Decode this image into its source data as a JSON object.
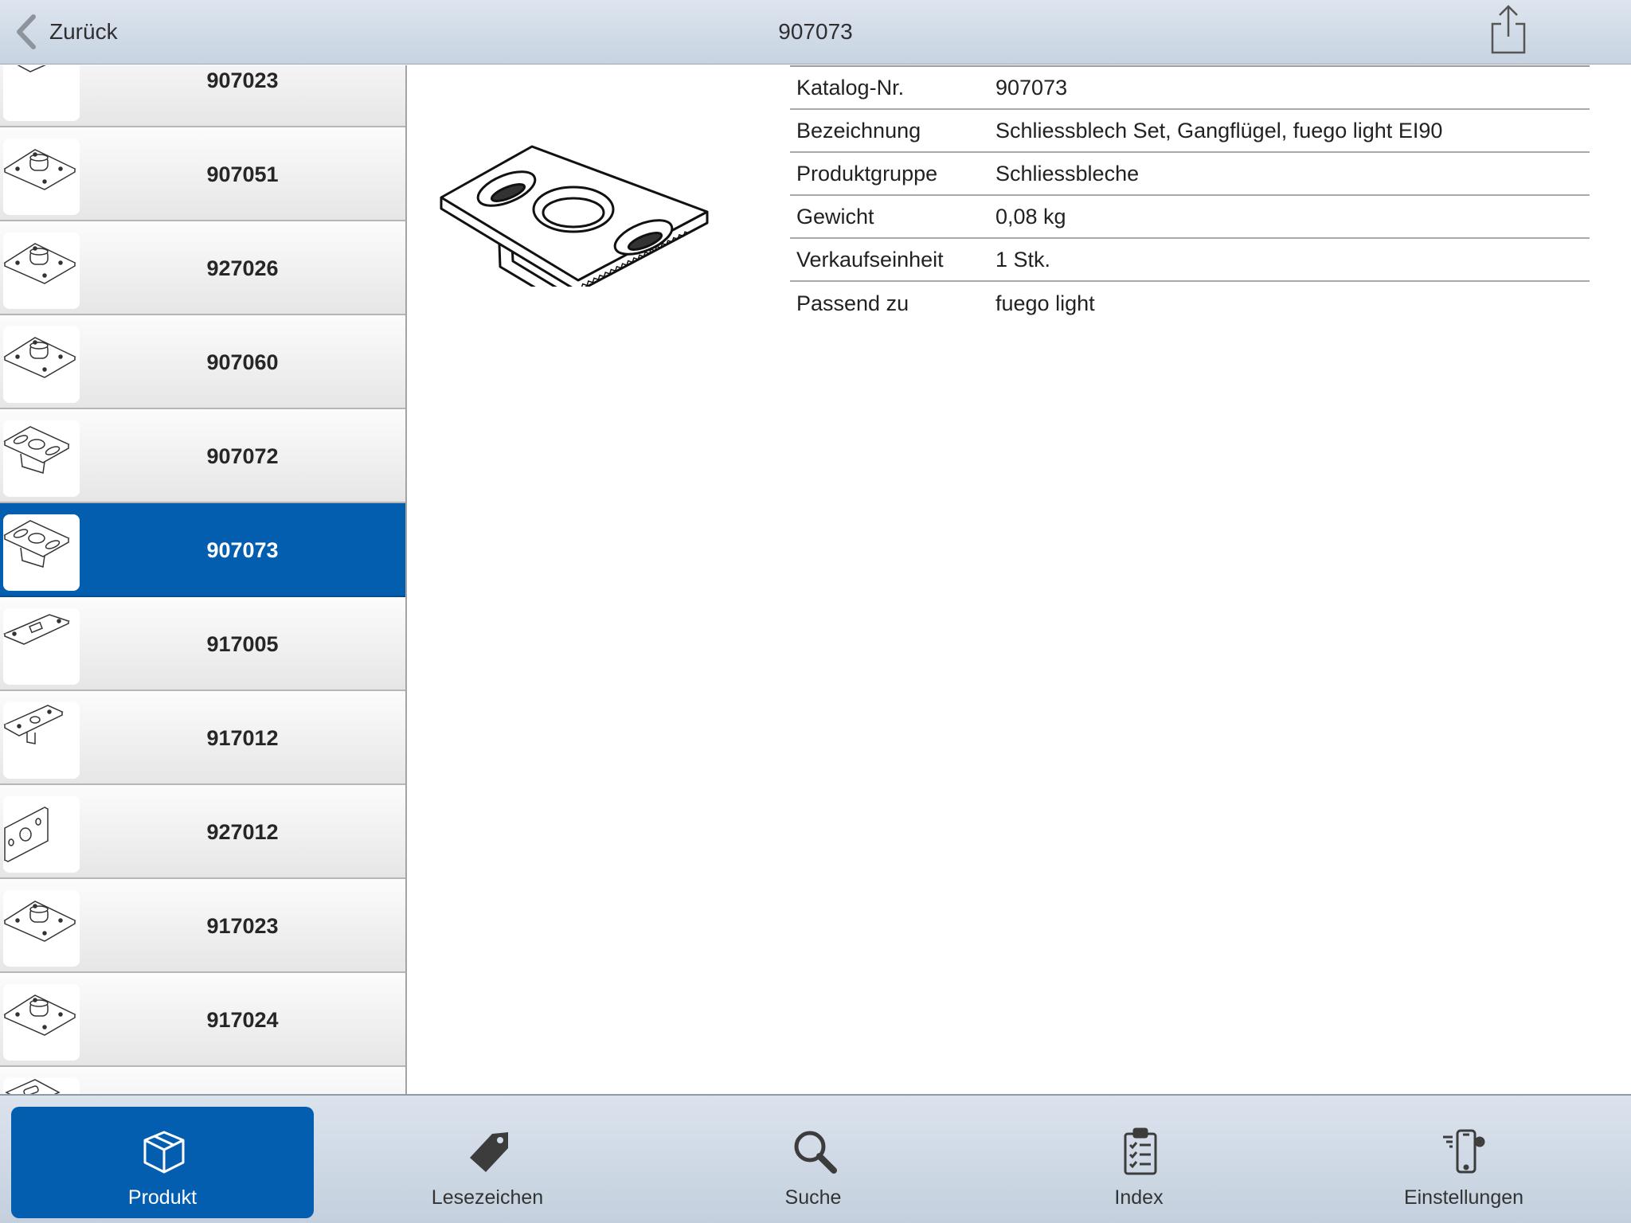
{
  "navbar": {
    "back_label": "Zurück",
    "title": "907073",
    "back_icon": "chevron-left-icon",
    "share_icon": "share-icon"
  },
  "product_list": {
    "items": [
      {
        "label": "907023",
        "thumb": "strike-plate-flat"
      },
      {
        "label": "907051",
        "thumb": "strike-plate-knob"
      },
      {
        "label": "927026",
        "thumb": "strike-plate-knob"
      },
      {
        "label": "907060",
        "thumb": "strike-plate-knob"
      },
      {
        "label": "907072",
        "thumb": "strike-plate-slots"
      },
      {
        "label": "907073",
        "thumb": "strike-plate-slots",
        "selected": true
      },
      {
        "label": "917005",
        "thumb": "strike-plate-rect"
      },
      {
        "label": "917012",
        "thumb": "strike-plate-holes"
      },
      {
        "label": "927012",
        "thumb": "strike-plate-upright"
      },
      {
        "label": "917023",
        "thumb": "strike-plate-knob"
      },
      {
        "label": "917024",
        "thumb": "strike-plate-knob"
      },
      {
        "label": "",
        "thumb": "strike-plate-flat"
      }
    ]
  },
  "detail": {
    "rows": [
      {
        "key": "Katalog-Nr.",
        "value": "907073"
      },
      {
        "key": "Bezeichnung",
        "value": "Schliessblech Set, Gangflügel, fuego light EI90"
      },
      {
        "key": "Produktgruppe",
        "value": "Schliessbleche"
      },
      {
        "key": "Gewicht",
        "value": "0,08 kg"
      },
      {
        "key": "Verkaufseinheit",
        "value": "1 Stk."
      },
      {
        "key": "Passend zu",
        "value": "fuego light"
      }
    ]
  },
  "tabbar": {
    "tabs": [
      {
        "label": "Produkt",
        "icon": "box-icon",
        "active": true
      },
      {
        "label": "Lesezeichen",
        "icon": "tag-icon"
      },
      {
        "label": "Suche",
        "icon": "search-icon"
      },
      {
        "label": "Index",
        "icon": "clipboard-list-icon"
      },
      {
        "label": "Einstellungen",
        "icon": "phone-settings-icon"
      }
    ]
  },
  "colors": {
    "accent": "#045eb0",
    "nav_background": "#d2dce8",
    "list_row_background": "#efefef"
  }
}
